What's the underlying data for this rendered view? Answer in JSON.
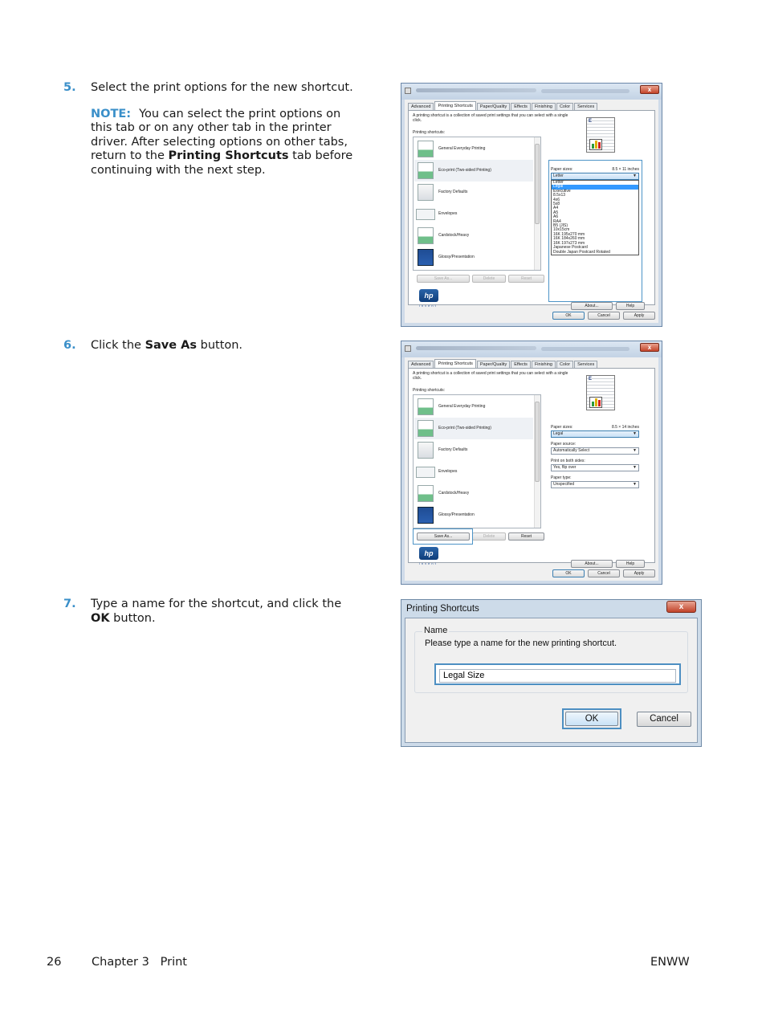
{
  "steps": [
    {
      "number": "5.",
      "text": "Select the print options for the new shortcut.",
      "note_label": "NOTE:",
      "note_parts": [
        "You can select the print options on this tab or on any other tab in the printer driver. After selecting options on other tabs, return to the ",
        "Printing Shortcuts",
        " tab before continuing with the next step."
      ]
    },
    {
      "number": "6.",
      "text_parts": [
        "Click the ",
        "Save As",
        " button."
      ]
    },
    {
      "number": "7.",
      "text_parts": [
        "Type a name for the shortcut, and click the ",
        "OK",
        " button."
      ]
    }
  ],
  "driver_dialog": {
    "close_glyph": "x",
    "tabs": [
      "Advanced",
      "Printing Shortcuts",
      "Paper/Quality",
      "Effects",
      "Finishing",
      "Color",
      "Services"
    ],
    "active_tab": "Printing Shortcuts",
    "description": "A printing shortcut is a collection of saved print settings that you can select with a single click.",
    "shortcuts_label": "Printing shortcuts:",
    "shortcuts": [
      {
        "label": "General Everyday Printing",
        "icon": "document-landscape-icon"
      },
      {
        "label": "Eco-print (Two-sided Printing)",
        "icon": "duplex-document-icon",
        "selected": true
      },
      {
        "label": "Factory Defaults",
        "icon": "blank-page-icon"
      },
      {
        "label": "Envelopes",
        "icon": "envelope-icon"
      },
      {
        "label": "Cardstock/Heavy",
        "icon": "cardstock-icon"
      },
      {
        "label": "Glossy/Presentation",
        "icon": "presentation-icon"
      }
    ],
    "buttons": {
      "save_as": "Save As...",
      "delete": "Delete",
      "reset": "Reset",
      "about": "About...",
      "help": "Help",
      "ok": "OK",
      "cancel": "Cancel",
      "apply": "Apply"
    },
    "hp_logo": "hp",
    "hp_sub": "invent",
    "paper_sizes_label": "Paper sizes:",
    "screenshot1": {
      "paper_dimensions": "8.5 × 11 inches",
      "paper_size_value": "Letter",
      "dropdown_options": [
        "Letter",
        "Legal",
        "Executive",
        "8.5x13",
        "4x6",
        "5x8",
        "A4",
        "A5",
        "A6",
        "RA4",
        "B5 (JIS)",
        "10x15cm",
        "16K 195x270 mm",
        "16K 184x260 mm",
        "16K 197x273 mm",
        "Japanese Postcard",
        "Double Japan Postcard Rotated"
      ],
      "highlighted_option": "Legal"
    },
    "screenshot2": {
      "paper_dimensions": "8.5 × 14 inches",
      "paper_size_value": "Legal",
      "paper_source_label": "Paper source:",
      "paper_source_value": "Automatically Select",
      "both_sides_label": "Print on both sides:",
      "both_sides_value": "Yes, flip over",
      "paper_type_label": "Paper type:",
      "paper_type_value": "Unspecified"
    }
  },
  "name_dialog": {
    "title": "Printing Shortcuts",
    "close_glyph": "x",
    "group_label": "Name",
    "prompt": "Please type a name for the new printing shortcut.",
    "name_value": "Legal Size",
    "ok": "OK",
    "cancel": "Cancel"
  },
  "footer": {
    "page_number": "26",
    "chapter": "Chapter 3   Print",
    "right": "ENWW"
  }
}
